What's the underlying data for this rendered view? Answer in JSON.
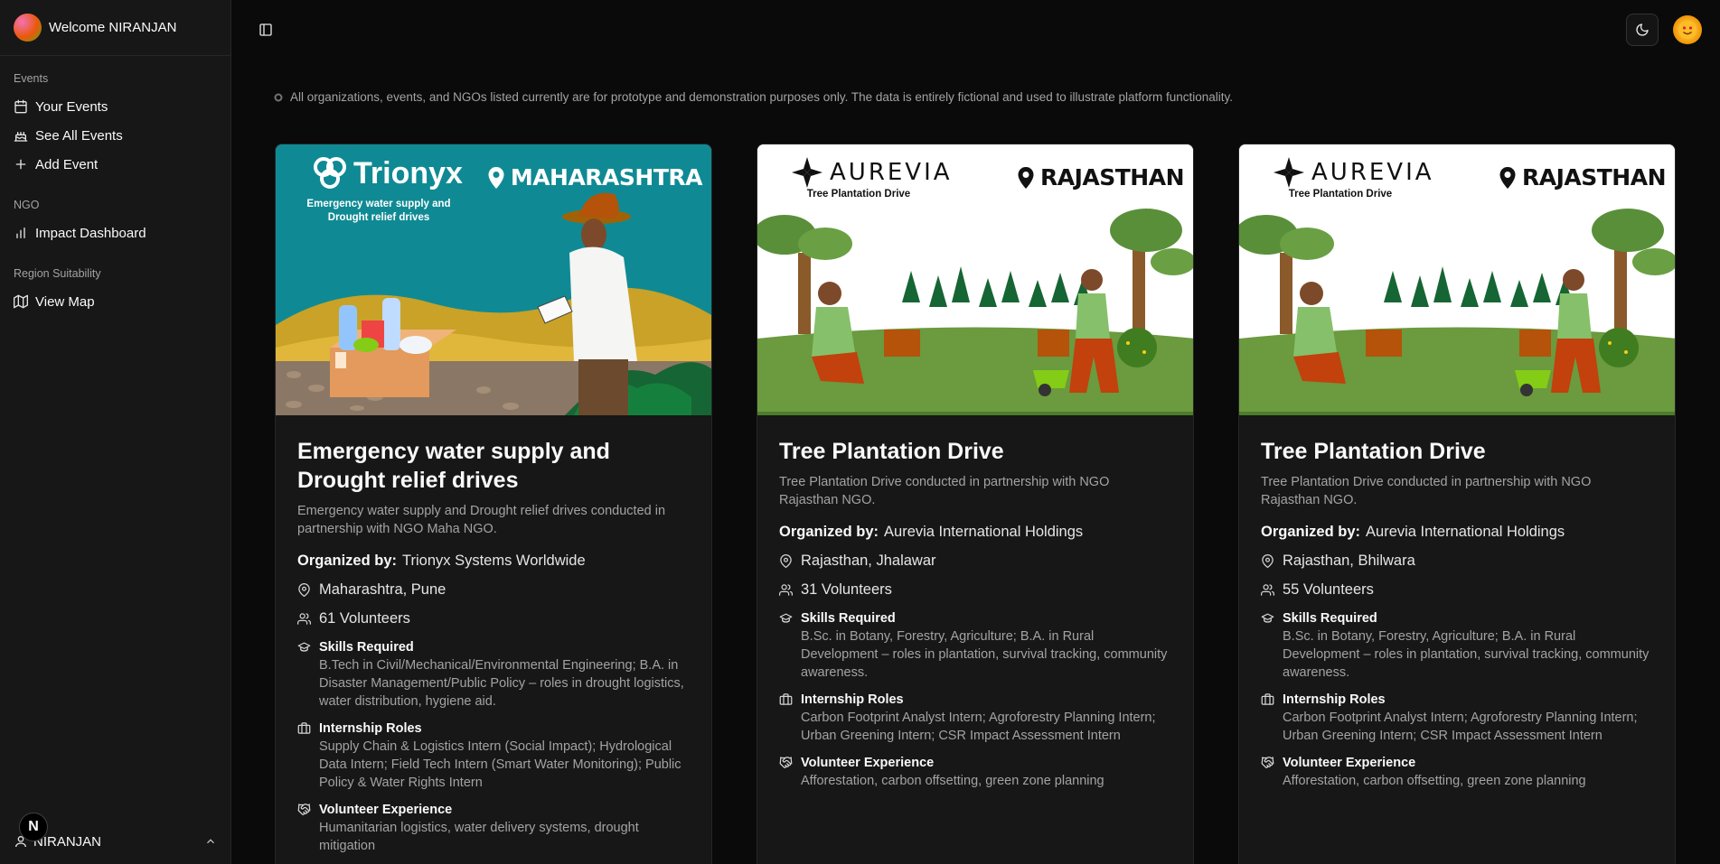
{
  "sidebar": {
    "welcome": "Welcome NIRANJAN",
    "groups": [
      {
        "label": "Events",
        "items": [
          {
            "label": "Your Events",
            "icon": "calendar-icon"
          },
          {
            "label": "See All Events",
            "icon": "cake-icon"
          },
          {
            "label": "Add Event",
            "icon": "plus-icon"
          }
        ]
      },
      {
        "label": "NGO",
        "items": [
          {
            "label": "Impact Dashboard",
            "icon": "bar-chart-icon"
          }
        ]
      },
      {
        "label": "Region Suitability",
        "items": [
          {
            "label": "View Map",
            "icon": "map-icon"
          }
        ]
      }
    ],
    "footer_user": "NIRANJAN",
    "badge": "N"
  },
  "notice": "All organizations, events, and NGOs listed currently are for prototype and demonstration purposes only. The data is entirely fictional and used to illustrate platform functionality.",
  "labels": {
    "organized_by": "Organized by:",
    "skills": "Skills Required",
    "roles": "Internship Roles",
    "experience": "Volunteer Experience"
  },
  "cards": [
    {
      "banner": {
        "brand": "Trionyx",
        "subtitle": "Emergency water supply and Drought relief drives",
        "state": "MAHARASHTRA",
        "bg": "#0f8a94"
      },
      "title": "Emergency water supply and Drought relief drives",
      "description": "Emergency water supply and Drought relief drives conducted in partnership with NGO Maha NGO.",
      "organizer": "Trionyx Systems Worldwide",
      "location": "Maharashtra, Pune",
      "volunteers": "61 Volunteers",
      "skills": "B.Tech in Civil/Mechanical/Environmental Engineering; B.A. in Disaster Management/Public Policy – roles in drought logistics, water distribution, hygiene aid.",
      "roles": "Supply Chain & Logistics Intern (Social Impact); Hydrological Data Intern; Field Tech Intern (Smart Water Monitoring); Public Policy & Water Rights Intern",
      "experience": "Humanitarian logistics, water delivery systems, drought mitigation"
    },
    {
      "banner": {
        "brand": "AUREVIA",
        "subtitle": "Tree Plantation Drive",
        "state": "RAJASTHAN",
        "bg": "#ffffff"
      },
      "title": "Tree Plantation Drive",
      "description": "Tree Plantation Drive conducted in partnership with NGO Rajasthan NGO.",
      "organizer": "Aurevia International Holdings",
      "location": "Rajasthan, Jhalawar",
      "volunteers": "31 Volunteers",
      "skills": "B.Sc. in Botany, Forestry, Agriculture; B.A. in Rural Development – roles in plantation, survival tracking, community awareness.",
      "roles": "Carbon Footprint Analyst Intern; Agroforestry Planning Intern; Urban Greening Intern; CSR Impact Assessment Intern",
      "experience": "Afforestation, carbon offsetting, green zone planning"
    },
    {
      "banner": {
        "brand": "AUREVIA",
        "subtitle": "Tree Plantation Drive",
        "state": "RAJASTHAN",
        "bg": "#ffffff"
      },
      "title": "Tree Plantation Drive",
      "description": "Tree Plantation Drive conducted in partnership with NGO Rajasthan NGO.",
      "organizer": "Aurevia International Holdings",
      "location": "Rajasthan, Bhilwara",
      "volunteers": "55 Volunteers",
      "skills": "B.Sc. in Botany, Forestry, Agriculture; B.A. in Rural Development – roles in plantation, survival tracking, community awareness.",
      "roles": "Carbon Footprint Analyst Intern; Agroforestry Planning Intern; Urban Greening Intern; CSR Impact Assessment Intern",
      "experience": "Afforestation, carbon offsetting, green zone planning"
    }
  ]
}
